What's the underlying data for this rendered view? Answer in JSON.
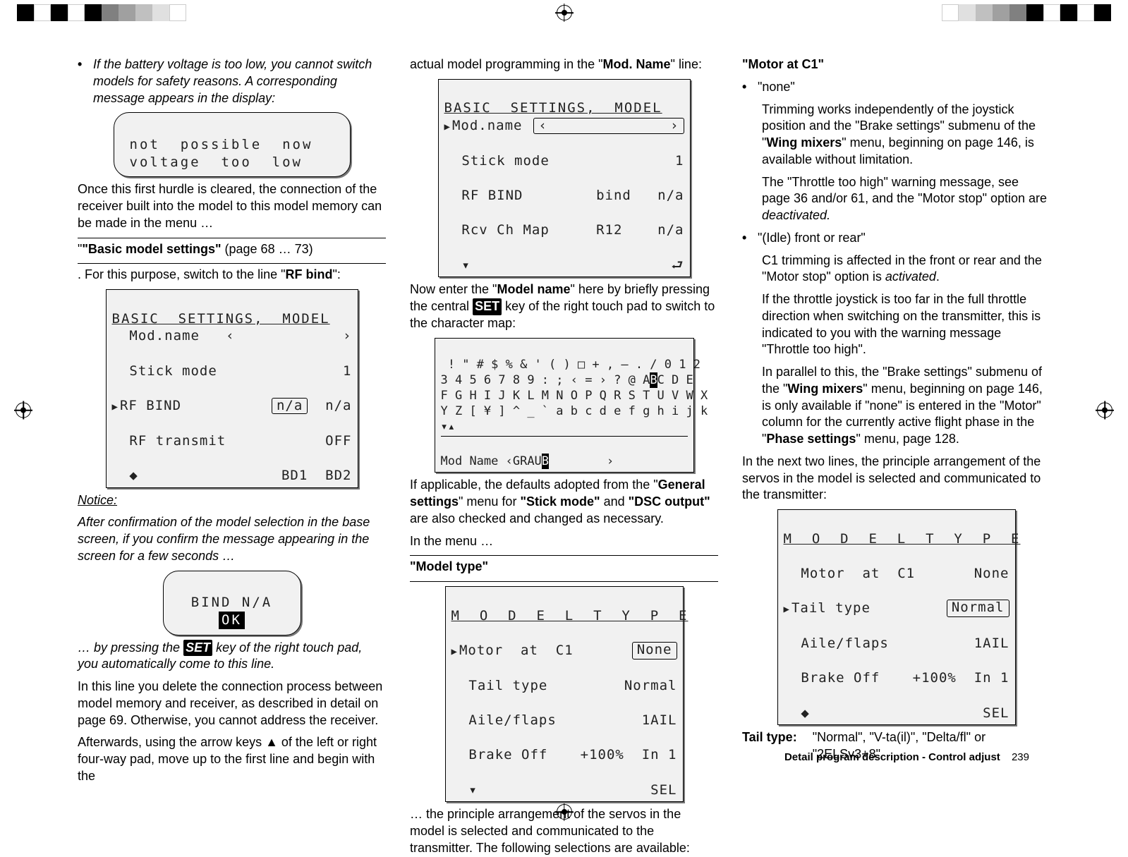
{
  "col1": {
    "bullet": "If the battery voltage is too low, you cannot switch models for safety reasons. A corresponding message appears in the display:",
    "lcd_not_possible_l1": "not  possible  now",
    "lcd_not_possible_l2": "voltage  too  low",
    "after_hurdle": "Once this first hurdle is cleared, the connection of the receiver built into the model to this model memory can be made in the menu …",
    "bms_heading_pre": "\"",
    "bms_heading_bold": "\"Basic model settings\"",
    "bms_heading_post": " (page 68 … 73)",
    "switch_line_pre": ". For this purpose, switch to the line \"",
    "switch_line_bold": "RF bind",
    "switch_line_post": "\":",
    "lcd_basic": {
      "title": "BASIC  SETTINGS,  MODEL",
      "r1_l": "Mod.name",
      "r1_m": "‹",
      "r1_r": "›",
      "r2_l": "Stick mode",
      "r2_r": "1",
      "r3_l": "RF BIND",
      "r3_m": "n/a",
      "r3_r": "n/a",
      "r4_l": "RF transmit",
      "r4_r": "OFF",
      "r5_m": "BD1",
      "r5_r": "BD2",
      "arrows": "◆"
    },
    "notice_label": "Notice:",
    "notice_text": "After confirmation of the model selection in the base screen, if you confirm the message appearing in the screen for a few seconds …",
    "lcd_bind_title": "BIND N/A",
    "lcd_bind_ok": "OK",
    "by_pressing_pre": "… by pressing the ",
    "set_key": "SET",
    "by_pressing_post": " key of the right touch pad, you automatically come to this line.",
    "inline_delete": "In this line you delete the connection process between model memory and receiver, as described in detail on page 69. Otherwise, you cannot address the receiver.",
    "afterwards": "Afterwards, using the arrow keys ▲ of the left or right four-way pad, move up to the first line and begin with the"
  },
  "col2": {
    "top_line_pre": "actual model programming in the \"",
    "top_line_bold": "Mod. Name",
    "top_line_post": "\" line:",
    "lcd_basic2": {
      "title": "BASIC  SETTINGS,  MODEL",
      "r1_l": "Mod.name",
      "r1_box_l": "‹",
      "r1_box_r": "›",
      "r2_l": "Stick mode",
      "r2_r": "1",
      "r3_l": "RF BIND",
      "r3_m": "bind",
      "r3_r": "n/a",
      "r4_l": "Rcv Ch Map",
      "r4_m": "R12",
      "r4_r": "n/a",
      "arrow_dn": "▾",
      "ret_icon": "⮐"
    },
    "enter_name_pre": "Now enter the \"",
    "enter_name_bold": "Model name",
    "enter_name_mid": "\" here by briefly pressing the central ",
    "enter_name_post": " key of the right touch pad to switch to the character map:",
    "charmap_l1": " ! \" # $ % & ' ( ) □ + , – . / 0 1 2",
    "charmap_l2_pre": "3 4 5 6 7 8 9 : ; ‹ = › ? @ A",
    "charmap_l2_hl": "B",
    "charmap_l2_post": "C D E",
    "charmap_l3": "F G H I J K L M N O P Q R S T U V W X",
    "charmap_l4": "Y Z [ ¥ ] ^ _ ` a b c d e f g h i j k",
    "charmap_arrows": "▾▴",
    "charmap_name_pre": "Mod Name ‹GRAU",
    "charmap_name_hl": "B",
    "charmap_name_post": "        ›",
    "gensettings_pre": "If applicable, the defaults adopted from the \"",
    "gensettings_b1": "General settings",
    "gensettings_mid1": "\" menu for ",
    "gensettings_b2": "\"Stick mode\"",
    "gensettings_and": " and ",
    "gensettings_b3": "\"DSC output\"",
    "gensettings_post": " are also checked and changed as necessary.",
    "in_menu": "In the menu …",
    "model_type_h": "\"Model type\"",
    "lcd_modeltype": {
      "title": "M  O  D  E  L  T  Y  P  E",
      "r1_l": "Motor  at  C1",
      "r1_r": "None",
      "r2_l": "Tail type",
      "r2_r": "Normal",
      "r3_l": "Aile/flaps",
      "r3_r": "1AIL",
      "r4_l": "Brake Off",
      "r4_m": "+100%",
      "r4_r": "In 1",
      "arrow_dn": "▾",
      "sel": "SEL"
    },
    "tail": "… the principle arrangement of the servos in the model is selected and communicated to the transmitter. The following selections are available:"
  },
  "col3": {
    "motor_c1_h": "\"Motor at C1\"",
    "none_label": "\"none\"",
    "none_p1_pre": "Trimming works independently of the joystick position and the \"Brake settings\" submenu of the \"",
    "none_p1_b": "Wing mixers",
    "none_p1_post": "\" menu, beginning on page 146, is available without limitation.",
    "none_p2_pre": "The \"Throttle too high\" warning message, see page 36 and/or 61, and the \"Motor stop\" option are ",
    "none_p2_it": "deactivated.",
    "idle_label": "\"(Idle) front or rear\"",
    "idle_p1_pre": "C1 trimming is affected in the front or rear and the \"Motor stop\" option is ",
    "idle_p1_it": "activated",
    "idle_p1_post": ".",
    "idle_p2": "If the throttle joystick is too far in the full throttle direction when switching on the transmitter, this is indicated to you with the warning message \"Throttle too high\".",
    "idle_p3_pre": "In parallel to this, the \"Brake settings\" submenu of the \"",
    "idle_p3_b1": "Wing mixers",
    "idle_p3_mid": "\" menu, beginning on page 146, is only available if \"none\" is entered in the \"Motor\" column for the currently active flight phase in the \"",
    "idle_p3_b2": "Phase settings",
    "idle_p3_post": "\" menu, page 128.",
    "next_two": "In the next two lines, the principle arrangement of the servos in the model is selected and communicated to the transmitter:",
    "lcd_modeltype2": {
      "title": "M  O  D  E  L  T  Y  P  E",
      "r1_l": "Motor  at  C1",
      "r1_r": "None",
      "r2_l": "Tail type",
      "r2_r": "Normal",
      "r3_l": "Aile/flaps",
      "r3_r": "1AIL",
      "r4_l": "Brake Off",
      "r4_m": "+100%",
      "r4_r": "In 1",
      "arrows": "◆",
      "sel": "SEL"
    },
    "tailtype_label": "Tail type",
    "tailtype_val": "\"Normal\", \"V-ta(il)\", \"Delta/fl\" or \"2ELSv3+8\""
  },
  "footer": {
    "section": "Detail program description - Control adjust",
    "page": "239"
  }
}
